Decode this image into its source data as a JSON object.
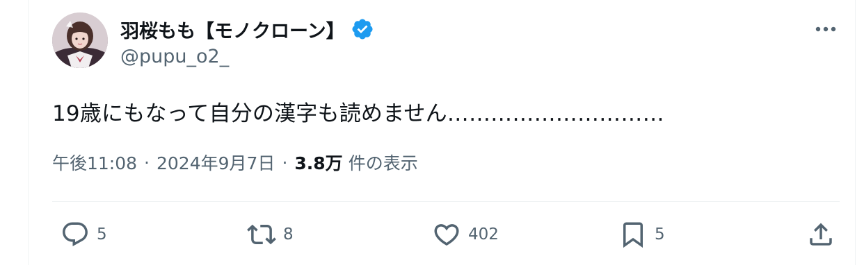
{
  "author": {
    "display_name": "羽桜もも【モノクローン】",
    "handle": "@pupu_o2_",
    "verified_icon": "verified-badge-icon",
    "avatar_icon": "profile-photo"
  },
  "menu": {
    "icon": "more-horizontal-icon"
  },
  "tweet": {
    "text": "19歳にもなって自分の漢字も読めません…………………………"
  },
  "meta": {
    "time": "午後11:08",
    "separator1": "·",
    "date": "2024年9月7日",
    "separator2": "·",
    "views_count": "3.8万",
    "views_label": "件の表示"
  },
  "actions": {
    "reply": {
      "icon": "reply-icon",
      "count": "5"
    },
    "retweet": {
      "icon": "retweet-icon",
      "count": "8"
    },
    "like": {
      "icon": "heart-icon",
      "count": "402"
    },
    "bookmark": {
      "icon": "bookmark-icon",
      "count": "5"
    },
    "share": {
      "icon": "share-icon"
    }
  },
  "colors": {
    "text_primary": "#0f1419",
    "text_secondary": "#536471",
    "verified_blue": "#1d9bf0",
    "divider": "#eff3f4"
  }
}
